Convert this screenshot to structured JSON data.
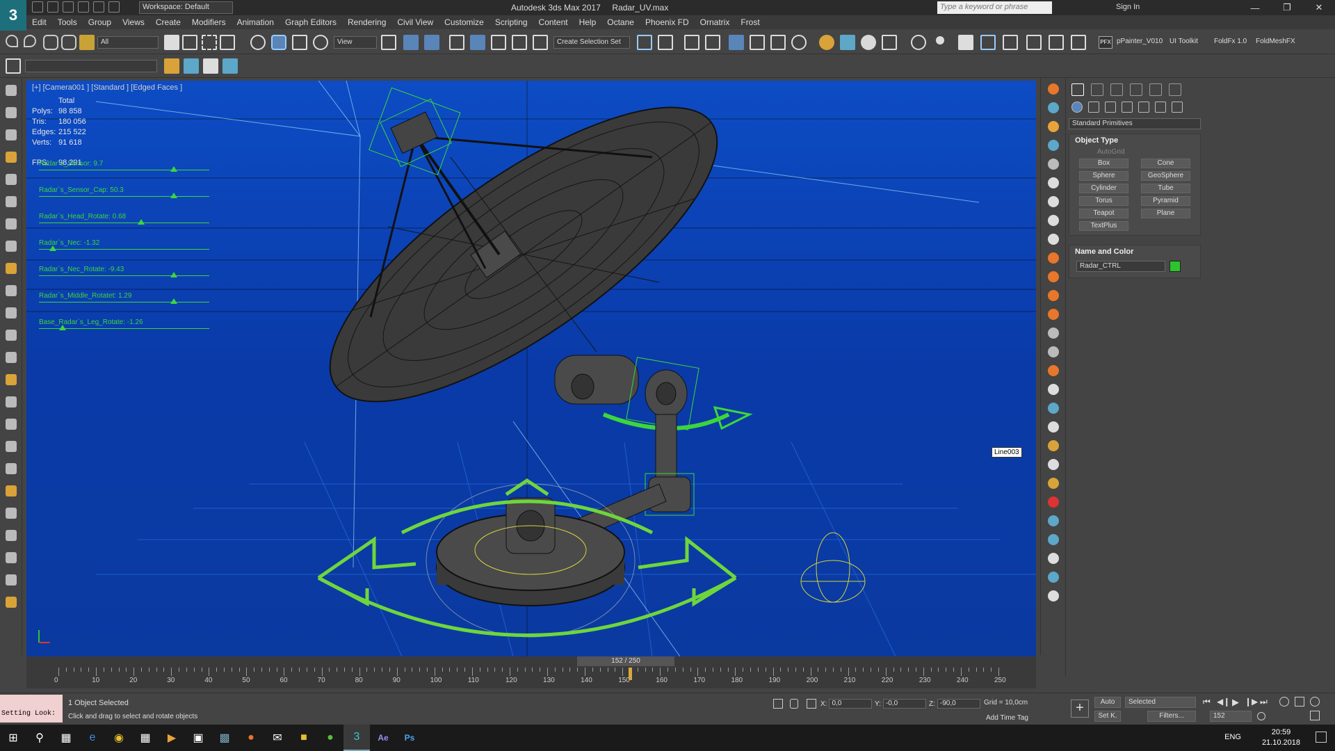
{
  "titlebar": {
    "workspace": "Workspace: Default",
    "app_title": "Autodesk 3ds Max 2017",
    "file_name": "Radar_UV.max",
    "search_placeholder": "Type a keyword or phrase",
    "sign_in": "Sign In"
  },
  "menu": [
    "Edit",
    "Tools",
    "Group",
    "Views",
    "Create",
    "Modifiers",
    "Animation",
    "Graph Editors",
    "Rendering",
    "Civil View",
    "Customize",
    "Scripting",
    "Content",
    "Help",
    "Octane",
    "Phoenix FD",
    "Ornatrix",
    "Frost"
  ],
  "toolbar": {
    "filter_all": "All",
    "ref_coord": "View",
    "selection_set": "Create Selection Set",
    "plugins": [
      "pPainter_V010",
      "UI Toolkit",
      "FoldFx 1.0",
      "FoldMeshFX"
    ]
  },
  "viewport": {
    "label": "[+] [Camera001 ] [Standard ] [Edged Faces ]",
    "stats_header": "Total",
    "stats": [
      {
        "k": "Polys:",
        "v": "98 858"
      },
      {
        "k": "Tris:",
        "v": "180 056"
      },
      {
        "k": "Edges:",
        "v": "215 522"
      },
      {
        "k": "Verts:",
        "v": "91 618"
      }
    ],
    "fps_label": "FPS:",
    "fps_value": "98,291",
    "sliders": [
      {
        "label": "Radar`s_Sensor: 9.7",
        "pos": 0.79
      },
      {
        "label": "Radar`s_Sensor_Cap: 50.3",
        "pos": 0.79
      },
      {
        "label": "Radar`s_Head_Rotate: 0.68",
        "pos": 0.6
      },
      {
        "label": "Radar`s_Nec: -1.32",
        "pos": 0.08
      },
      {
        "label": "Radar`s_Nec_Rotate: -9.43",
        "pos": 0.79
      },
      {
        "label": "Radar`s_Middle_Rotatet: 1.29",
        "pos": 0.79
      },
      {
        "label": "Base_Radar`s_Leg_Rotate: -1.26",
        "pos": 0.14
      }
    ],
    "object_tag": "Line003"
  },
  "command_panel": {
    "category": "Standard Primitives",
    "object_type_title": "Object Type",
    "autogrid": "AutoGrid",
    "primitives": [
      "Box",
      "Cone",
      "Sphere",
      "GeoSphere",
      "Cylinder",
      "Tube",
      "Torus",
      "Pyramid",
      "Teapot",
      "Plane",
      "TextPlus"
    ],
    "name_color_title": "Name and Color",
    "object_name": "Radar_CTRL",
    "object_color": "#2ec42e"
  },
  "timeline": {
    "frame_indicator": "152 / 250",
    "current": 152,
    "total": 250,
    "ticks": [
      "0",
      "10",
      "20",
      "30",
      "40",
      "50",
      "60",
      "70",
      "80",
      "90",
      "100",
      "110",
      "120",
      "130",
      "140",
      "150",
      "160",
      "170",
      "180",
      "190",
      "200",
      "210",
      "220",
      "230",
      "240",
      "250"
    ]
  },
  "status": {
    "script_text": "Setting Look:",
    "selection": "1 Object Selected",
    "prompt": "Click and drag to select and rotate objects",
    "x_label": "X:",
    "x": "0,0",
    "y_label": "Y:",
    "y": "-0,0",
    "z_label": "Z:",
    "z": "-90,0",
    "grid": "Grid = 10,0cm",
    "add_time_tag": "Add Time Tag",
    "auto": "Auto",
    "selected": "Selected",
    "set_key": "Set K.",
    "filters": "Filters...",
    "frame": "152"
  },
  "taskbar": {
    "lang": "ENG",
    "time": "20:59",
    "date": "21.10.2018"
  }
}
